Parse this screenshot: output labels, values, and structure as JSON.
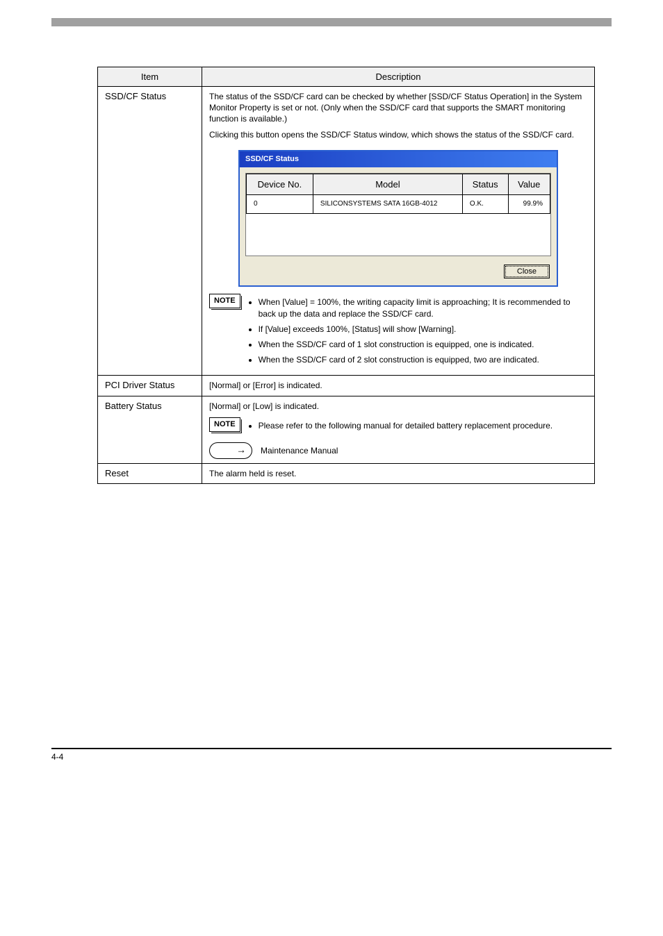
{
  "table": {
    "header_item": "Item",
    "header_desc": "Description",
    "rows": [
      {
        "item": "SSD/CF Status",
        "desc_intro": "The status of the SSD/CF card can be checked by whether [SSD/CF Status Operation] in the System Monitor Property is set or not. (Only when the SSD/CF card that supports the SMART monitoring function is available.)",
        "desc_intro2": "Clicking this button opens the SSD/CF Status window, which shows the status of the SSD/CF card.",
        "note_lines": [
          "When [Value] = 100%, the writing capacity limit is approaching; It is recommended to back up the data and replace the SSD/CF card.",
          "If [Value] exceeds 100%, [Status] will show [Warning].",
          "When the SSD/CF card of 1 slot construction is equipped, one is indicated.",
          "When the SSD/CF card of 2 slot construction is equipped, two are indicated."
        ]
      },
      {
        "item": "PCI Driver Status",
        "desc": "[Normal] or [Error] is indicated."
      },
      {
        "item": "Battery Status",
        "desc": "[Normal] or [Low] is indicated.",
        "note": "Please refer to the following manual for detailed battery replacement procedure.",
        "see": "Maintenance Manual"
      },
      {
        "item": "Reset",
        "desc": "The alarm held is reset."
      }
    ]
  },
  "dialog": {
    "title": "SSD/CF Status",
    "cols": {
      "c1": "Device No.",
      "c2": "Model",
      "c3": "Status",
      "c4": "Value"
    },
    "row": {
      "c1": "0",
      "c2": "SILICONSYSTEMS SATA 16GB-4012",
      "c3": "O.K.",
      "c4": "99.9%"
    },
    "close": "Close"
  },
  "footer": {
    "left": "4-4",
    "right": ""
  }
}
